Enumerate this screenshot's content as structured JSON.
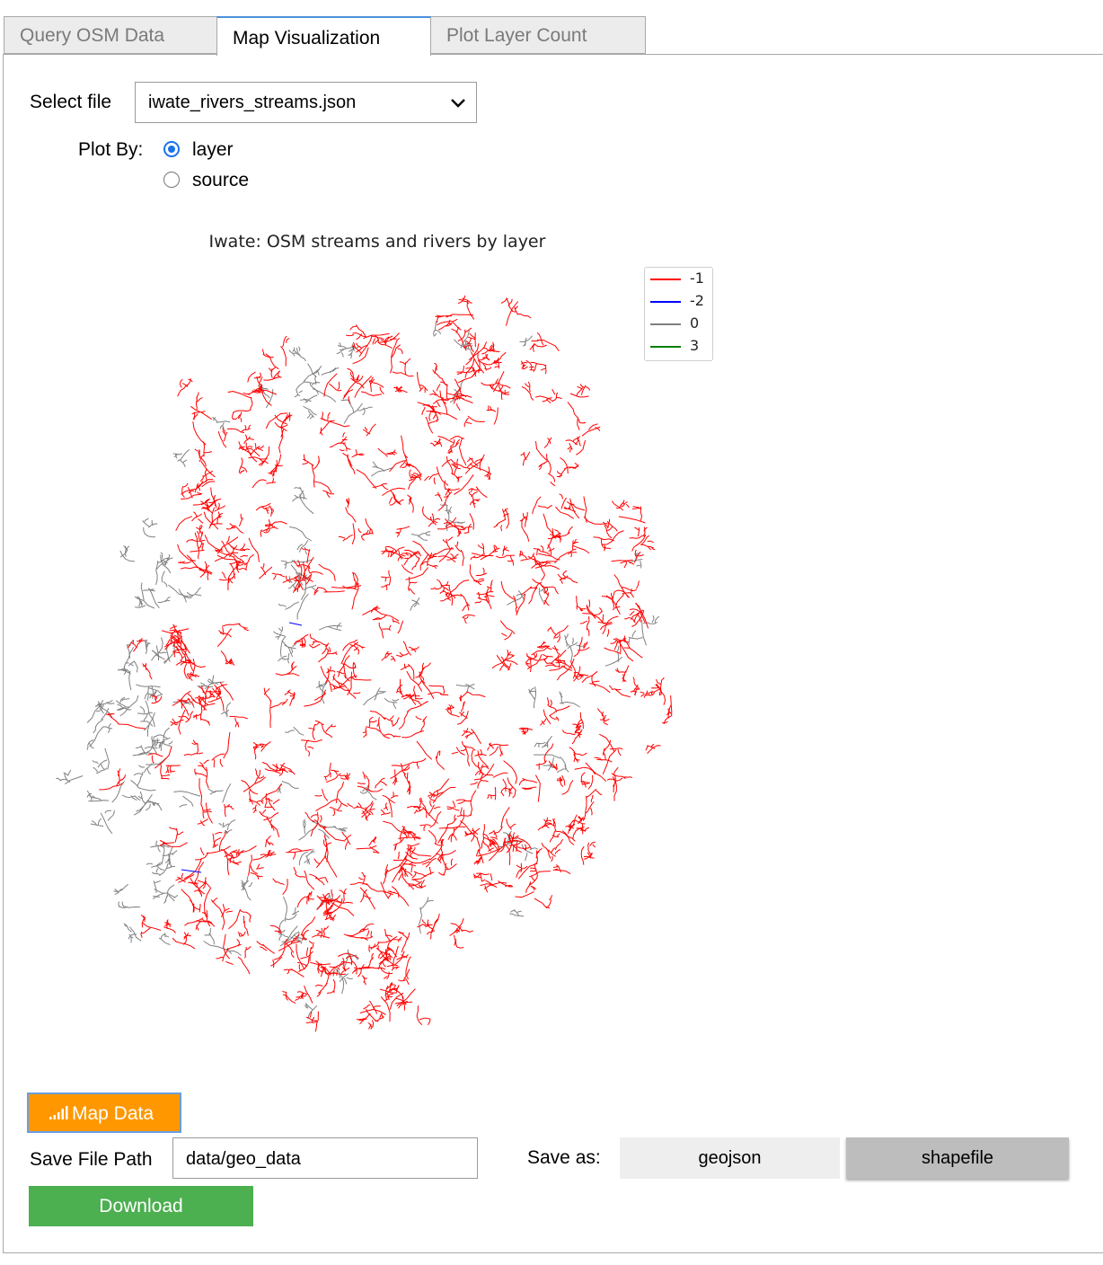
{
  "tabs": [
    {
      "label": "Query OSM Data",
      "active": false
    },
    {
      "label": "Map Visualization",
      "active": true
    },
    {
      "label": "Plot Layer Count",
      "active": false
    }
  ],
  "select_file": {
    "label": "Select file",
    "value": "iwate_rivers_streams.json",
    "icon": "chevron-down-icon"
  },
  "plot_by": {
    "label": "Plot By:",
    "options": [
      {
        "label": "layer",
        "selected": true
      },
      {
        "label": "source",
        "selected": false
      }
    ]
  },
  "chart_data": {
    "type": "map",
    "title": "Iwate: OSM streams and rivers by layer",
    "legend_position": "top-right",
    "series": [
      {
        "name": "-1",
        "color": "#ff0000"
      },
      {
        "name": "-2",
        "color": "#0000ff"
      },
      {
        "name": "0",
        "color": "#808080"
      },
      {
        "name": "3",
        "color": "#008000"
      }
    ]
  },
  "map_button": {
    "label": "Map Data",
    "icon": "bar-chart-icon",
    "color": "#ff9800"
  },
  "save": {
    "path_label": "Save File Path",
    "path_value": "data/geo_data",
    "as_label": "Save as:",
    "formats": [
      "geojson",
      "shapefile"
    ],
    "selected_format": "shapefile"
  },
  "download_button": {
    "label": "Download",
    "color": "#4caf50"
  }
}
